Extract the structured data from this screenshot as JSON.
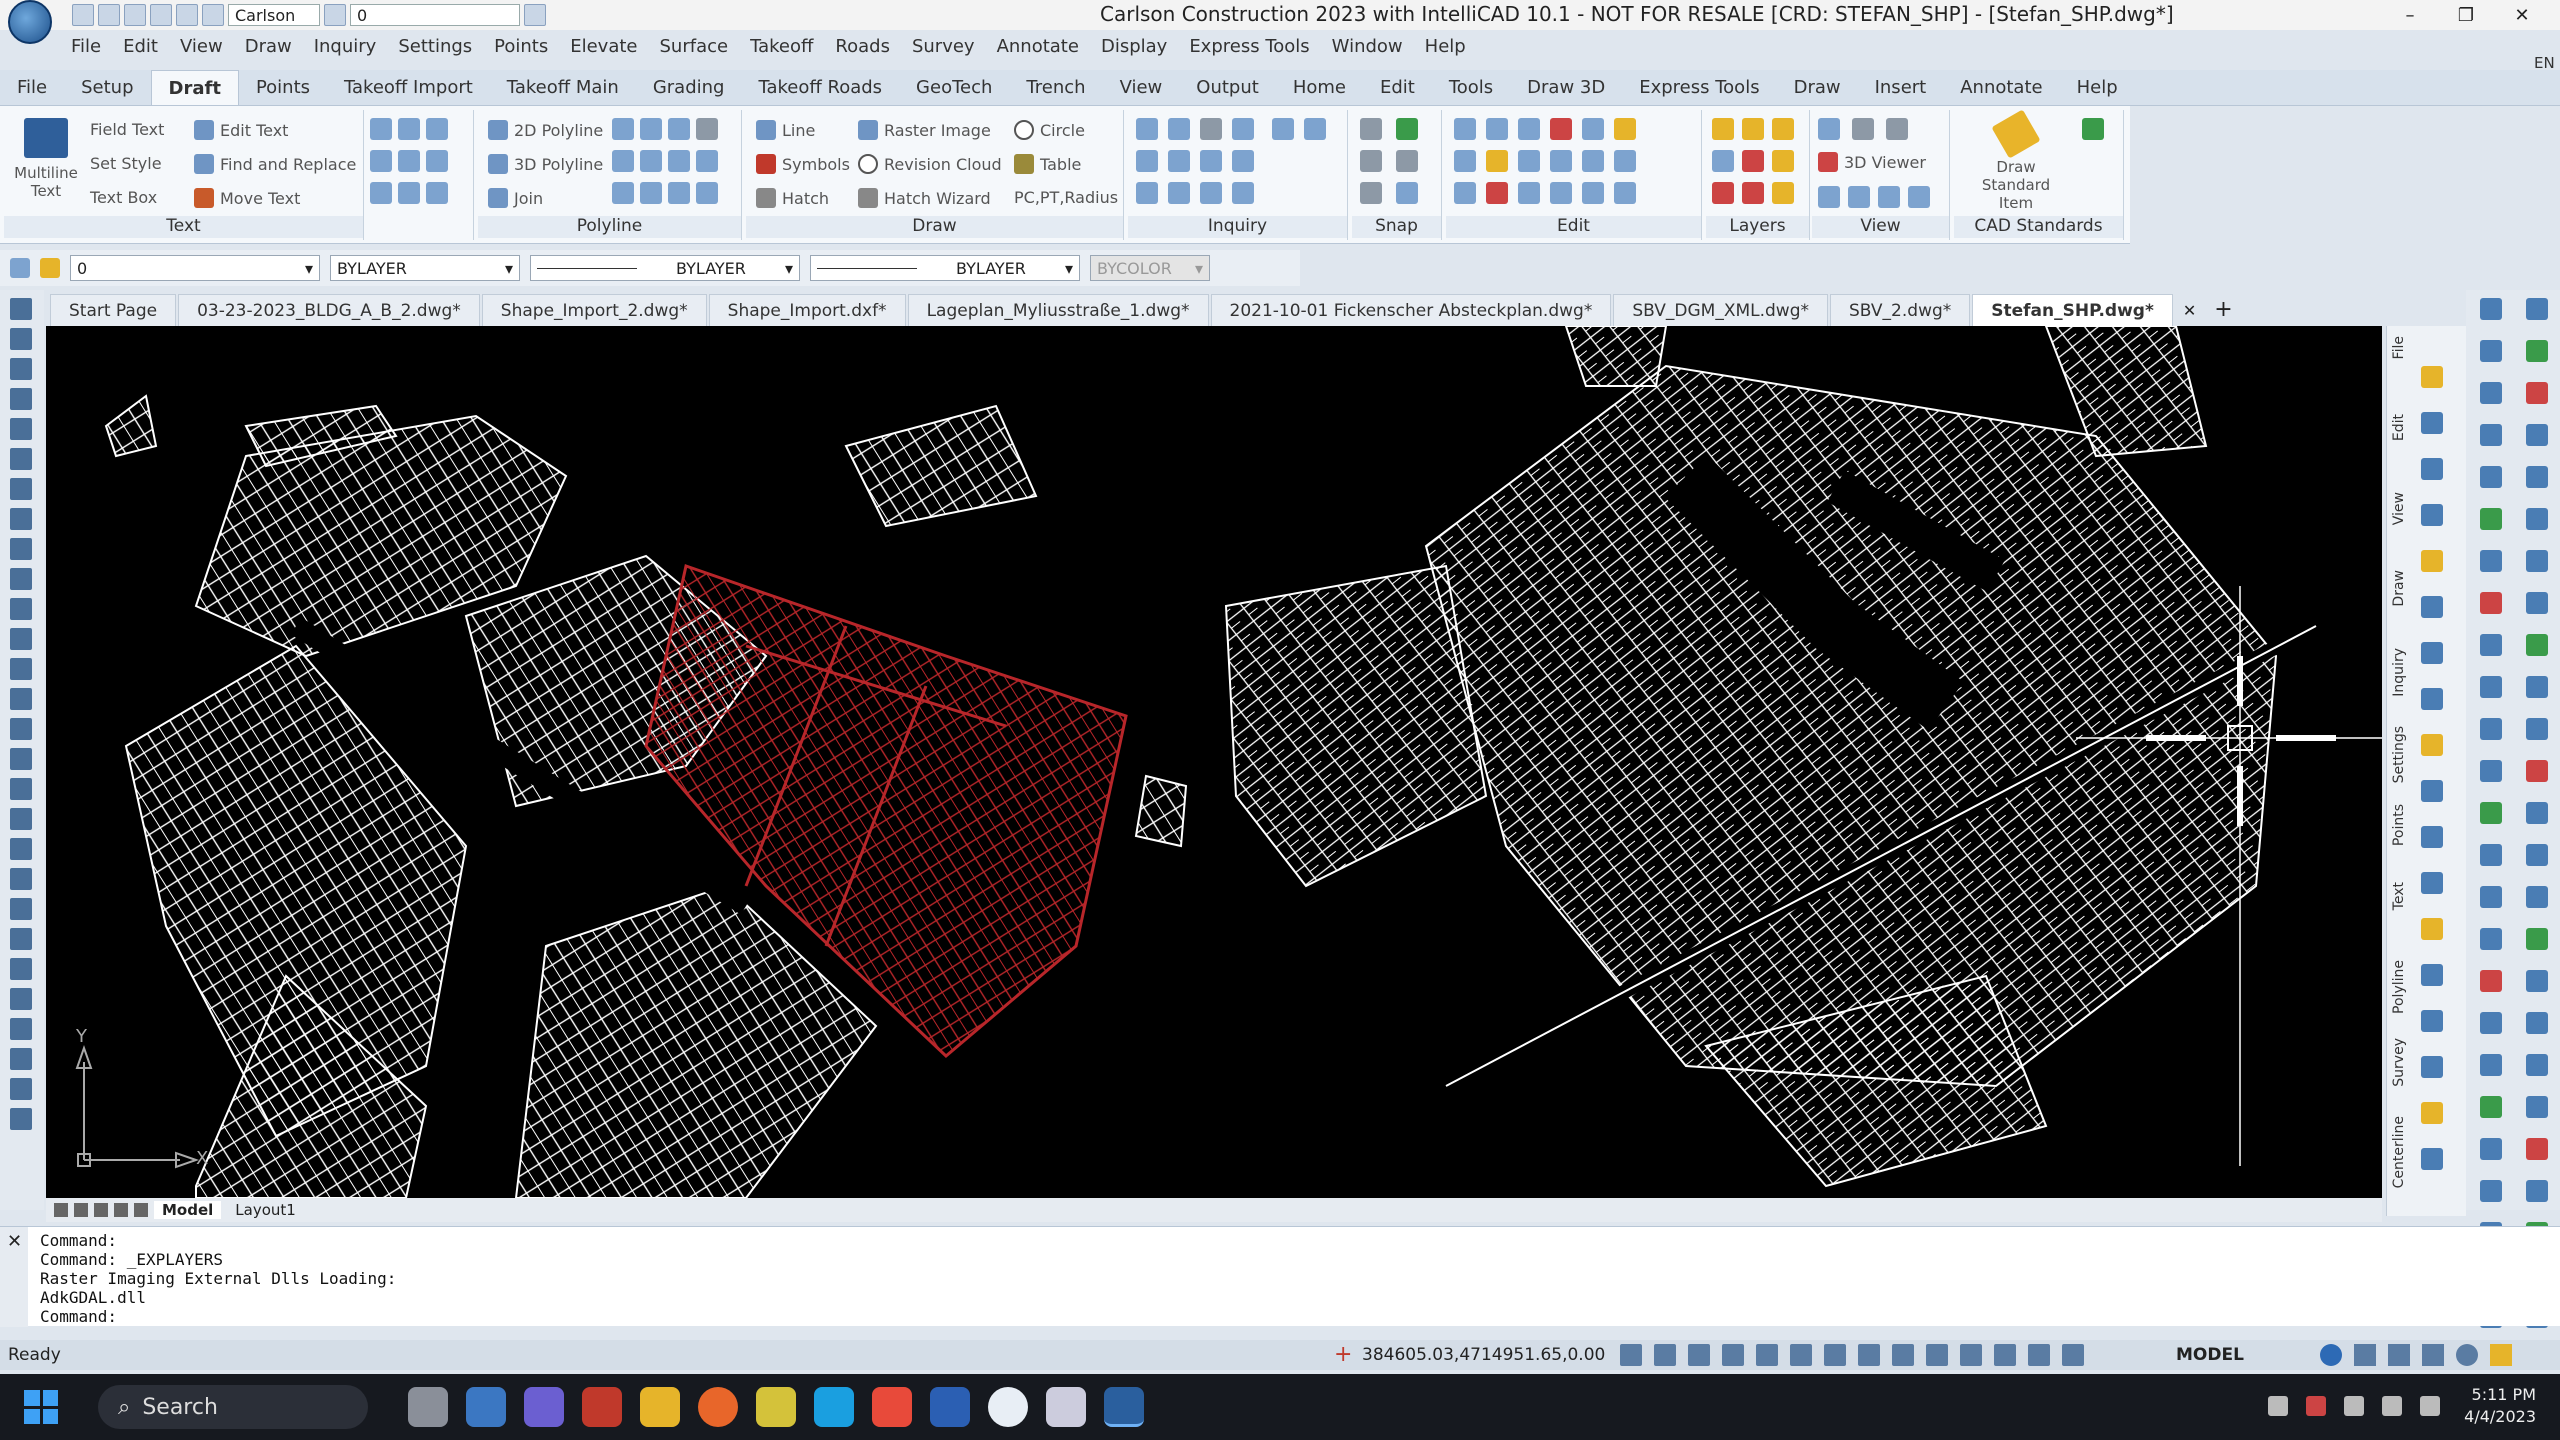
{
  "window": {
    "title": "Carlson Construction 2023 with IntelliCAD 10.1 - NOT FOR RESALE [CRD: STEFAN_SHP] - [Stefan_SHP.dwg*]",
    "qat_profile": "Carlson",
    "qat_layer": "0"
  },
  "menus": [
    "File",
    "Edit",
    "View",
    "Draw",
    "Inquiry",
    "Settings",
    "Points",
    "Elevate",
    "Surface",
    "Takeoff",
    "Roads",
    "Survey",
    "Annotate",
    "Display",
    "Express Tools",
    "Window",
    "Help"
  ],
  "ribbon_tabs": [
    "File",
    "Setup",
    "Draft",
    "Points",
    "Takeoff Import",
    "Takeoff Main",
    "Grading",
    "Takeoff Roads",
    "GeoTech",
    "Trench",
    "View",
    "Output",
    "Home",
    "Edit",
    "Tools",
    "Draw 3D",
    "Express Tools",
    "Draw",
    "Insert",
    "Annotate",
    "Help"
  ],
  "ribbon": {
    "text": {
      "title": "Text",
      "multiline": "Multiline Text",
      "field_text": "Field Text",
      "edit_text": "Edit Text",
      "set_style": "Set Style",
      "find_replace": "Find and Replace",
      "text_box": "Text Box",
      "move_text": "Move Text"
    },
    "polyline": {
      "title": "Polyline",
      "poly2d": "2D Polyline",
      "poly3d": "3D Polyline",
      "join": "Join"
    },
    "draw": {
      "title": "Draw",
      "line": "Line",
      "raster_image": "Raster Image",
      "circle": "Circle",
      "symbols": "Symbols",
      "revision_cloud": "Revision Cloud",
      "table": "Table",
      "hatch": "Hatch",
      "hatch_wizard": "Hatch Wizard",
      "pc_pt_radius": "PC,PT,Radius"
    },
    "inquiry": {
      "title": "Inquiry"
    },
    "snap": {
      "title": "Snap"
    },
    "edit": {
      "title": "Edit"
    },
    "layers": {
      "title": "Layers"
    },
    "view": {
      "title": "View",
      "viewer3d": "3D Viewer"
    },
    "cad_standards": {
      "title": "CAD Standards",
      "draw_standard": "Draw Standard Item"
    }
  },
  "properties": {
    "layer": "0",
    "color": "BYLAYER",
    "linetype": "BYLAYER",
    "lineweight": "BYLAYER",
    "plotstyle": "BYCOLOR"
  },
  "doc_tabs": [
    "Start Page",
    "03-23-2023_BLDG_A_B_2.dwg*",
    "Shape_Import_2.dwg*",
    "Shape_Import.dxf*",
    "Lageplan_Myliusstraße_1.dwg*",
    "2021-10-01 Fickenscher Absteckplan.dwg*",
    "SBV_DGM_XML.dwg*",
    "SBV_2.dwg*",
    "Stefan_SHP.dwg*"
  ],
  "active_doc": "Stefan_SHP.dwg*",
  "layout_tabs": [
    "Model",
    "Layout1"
  ],
  "right_dock_tabs": [
    "File",
    "Edit",
    "View",
    "Draw",
    "Inquiry",
    "Settings",
    "Points",
    "Text",
    "Polyline",
    "Survey",
    "Centerline"
  ],
  "command_history": "Command:\nCommand: _EXPLAYERS\nRaster Imaging External Dlls Loading:\nAdkGDAL.dll\nCommand:",
  "status": {
    "ready": "Ready",
    "coords": "384605.03,4714951.65,0.00",
    "model": "MODEL"
  },
  "ucs": {
    "x_label": "X",
    "y_label": "Y"
  },
  "taskbar": {
    "search": "Search",
    "time": "5:11 PM",
    "date": "4/4/2023",
    "lang": "EN"
  },
  "colors": {
    "canvas": "#000000",
    "parcel_lines": "#ffffff",
    "highlight": "#b8262a",
    "accent": "#3ea1f5"
  }
}
